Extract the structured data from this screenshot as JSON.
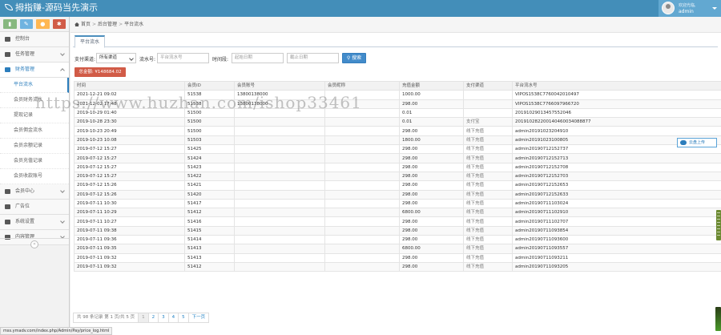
{
  "header": {
    "brand": "拇指赚-源码当先演示",
    "user_welcome": "欢迎光临,",
    "user_name": "admin"
  },
  "sidebar": {
    "shortcuts": [
      {
        "icon": "chart-icon",
        "color": "#87b87f"
      },
      {
        "icon": "pencil-icon",
        "color": "#6fb3e0"
      },
      {
        "icon": "users-icon",
        "color": "#ffb752"
      },
      {
        "icon": "cogs-icon",
        "color": "#d15b47"
      }
    ],
    "items": [
      {
        "label": "控制台",
        "icon": "dashboard-icon"
      },
      {
        "label": "任务管理",
        "icon": "flag-icon"
      },
      {
        "label": "财务管理",
        "icon": "list-icon",
        "open": true
      },
      {
        "label": "会员中心",
        "icon": "user-icon"
      },
      {
        "label": "广告位",
        "icon": "picture-icon"
      },
      {
        "label": "系统设置",
        "icon": "gear-icon"
      },
      {
        "label": "内容管理",
        "icon": "pencil-icon"
      }
    ],
    "sub_items": [
      "平台流水",
      "会员财务流水",
      "提现记录",
      "会员佣金流水",
      "会员余额记录",
      "会员充值记录",
      "会员收款账号"
    ]
  },
  "breadcrumb": {
    "home": "首页",
    "section": "后台管理",
    "page": "平台流水"
  },
  "tab": {
    "label": "平台流水"
  },
  "filters": {
    "type_label": "支付渠道:",
    "type_value": "所有渠道",
    "order_label": "流水号:",
    "order_placeholder": "平台流水号",
    "time_label": "时间段:",
    "start_placeholder": "起始日期",
    "end_placeholder": "截止日期",
    "search_label": "搜索"
  },
  "total": {
    "label": "总金额: ¥148684.02"
  },
  "table": {
    "headers": [
      "时间",
      "会员ID",
      "会员账号",
      "会员昵称",
      "充值金额",
      "支付渠道",
      "平台流水号"
    ],
    "rows": [
      [
        "2021-12-21 09:02",
        "51538",
        "13800138000",
        "",
        "1000.00",
        "",
        "VIPOS1538C7760042010497"
      ],
      [
        "2021-12-02 17:48",
        "51538",
        "13800138000",
        "",
        "298.00",
        "",
        "VIPOS1538C7766097966720"
      ],
      [
        "2019-10-29 01:40",
        "51500",
        "",
        "",
        "0.01",
        "",
        "20191029013457552046"
      ],
      [
        "2019-10-28 23:30",
        "51500",
        "",
        "",
        "0.01",
        "支付宝",
        "201910282200140460034088877"
      ],
      [
        "2019-10-23 20:49",
        "51500",
        "",
        "",
        "298.00",
        "线下充值",
        "admin20191023204910"
      ],
      [
        "2019-10-23 10:08",
        "51503",
        "",
        "",
        "1800.00",
        "线下充值",
        "admin20191023100805"
      ],
      [
        "2019-07-12 15:27",
        "51425",
        "",
        "",
        "298.00",
        "线下充值",
        "admin20190712152737"
      ],
      [
        "2019-07-12 15:27",
        "51424",
        "",
        "",
        "298.00",
        "线下充值",
        "admin20190712152713"
      ],
      [
        "2019-07-12 15:27",
        "51423",
        "",
        "",
        "298.00",
        "线下充值",
        "admin20190712152708"
      ],
      [
        "2019-07-12 15:27",
        "51422",
        "",
        "",
        "298.00",
        "线下充值",
        "admin20190712152703"
      ],
      [
        "2019-07-12 15:26",
        "51421",
        "",
        "",
        "298.00",
        "线下充值",
        "admin20190712152653"
      ],
      [
        "2019-07-12 15:26",
        "51420",
        "",
        "",
        "298.00",
        "线下充值",
        "admin20190712152633"
      ],
      [
        "2019-07-11 10:30",
        "51417",
        "",
        "",
        "298.00",
        "线下充值",
        "admin20190711103024"
      ],
      [
        "2019-07-11 10:29",
        "51412",
        "",
        "",
        "6800.00",
        "线下充值",
        "admin20190711102910"
      ],
      [
        "2019-07-11 10:27",
        "51416",
        "",
        "",
        "298.00",
        "线下充值",
        "admin20190711102707"
      ],
      [
        "2019-07-11 09:38",
        "51415",
        "",
        "",
        "298.00",
        "线下充值",
        "admin20190711093854"
      ],
      [
        "2019-07-11 09:36",
        "51414",
        "",
        "",
        "298.00",
        "线下充值",
        "admin20190711093600"
      ],
      [
        "2019-07-11 09:35",
        "51413",
        "",
        "",
        "6800.00",
        "线下充值",
        "admin20190711093557"
      ],
      [
        "2019-07-11 09:32",
        "51413",
        "",
        "",
        "298.00",
        "线下充值",
        "admin20190711093211"
      ],
      [
        "2019-07-11 09:32",
        "51412",
        "",
        "",
        "298.00",
        "线下充值",
        "admin20190711093205"
      ]
    ]
  },
  "pager": {
    "info": "共 98 条记录 第 1 页/共 5 页",
    "pages": [
      "1",
      "2",
      "3",
      "4",
      "5"
    ],
    "next": "下一页"
  },
  "cloud_button": {
    "label": "云盘上传"
  },
  "status_url": "mss.ymadv.com/index.php/Admin/Pay/price_log.html",
  "watermark": "https://www.huzhan.com/ishop33461"
}
